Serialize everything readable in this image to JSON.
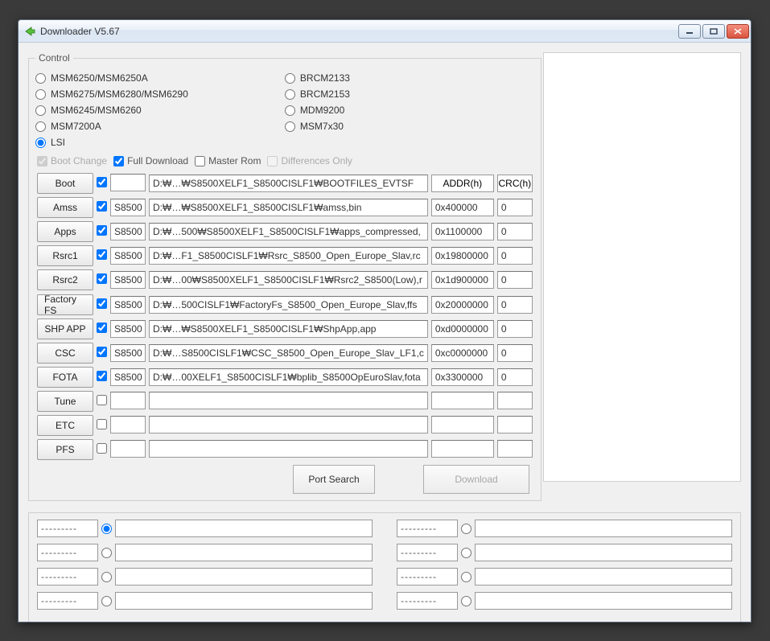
{
  "window": {
    "title": "Downloader V5.67"
  },
  "control": {
    "legend": "Control",
    "col1": [
      {
        "label": "MSM6250/MSM6250A",
        "selected": false
      },
      {
        "label": "MSM6275/MSM6280/MSM6290",
        "selected": false
      },
      {
        "label": "MSM6245/MSM6260",
        "selected": false
      },
      {
        "label": "MSM7200A",
        "selected": false
      },
      {
        "label": "LSI",
        "selected": true
      }
    ],
    "col2": [
      {
        "label": "BRCM2133",
        "selected": false
      },
      {
        "label": "BRCM2153",
        "selected": false
      },
      {
        "label": "MDM9200",
        "selected": false
      },
      {
        "label": "MSM7x30",
        "selected": false
      }
    ]
  },
  "options": {
    "boot_change": {
      "label": "Boot Change",
      "checked": true,
      "disabled": true
    },
    "full_download": {
      "label": "Full Download",
      "checked": true,
      "disabled": false
    },
    "master_rom": {
      "label": "Master Rom",
      "checked": false,
      "disabled": false
    },
    "differences_only": {
      "label": "Differences Only",
      "checked": false,
      "disabled": true
    }
  },
  "headers": {
    "addr": "ADDR(h)",
    "crc": "CRC(h)"
  },
  "rows": [
    {
      "btn": "Boot",
      "chk": true,
      "model": "",
      "path": "D:₩…₩S8500XELF1_S8500CISLF1₩BOOTFILES_EVTSF",
      "addr": "",
      "crc": ""
    },
    {
      "btn": "Amss",
      "chk": true,
      "model": "S8500",
      "path": "D:₩…₩S8500XELF1_S8500CISLF1₩amss,bin",
      "addr": "0x400000",
      "crc": "0"
    },
    {
      "btn": "Apps",
      "chk": true,
      "model": "S8500",
      "path": "D:₩…500₩S8500XELF1_S8500CISLF1₩apps_compressed,",
      "addr": "0x1100000",
      "crc": "0"
    },
    {
      "btn": "Rsrc1",
      "chk": true,
      "model": "S8500",
      "path": "D:₩…F1_S8500CISLF1₩Rsrc_S8500_Open_Europe_Slav,rc",
      "addr": "0x19800000",
      "crc": "0"
    },
    {
      "btn": "Rsrc2",
      "chk": true,
      "model": "S8500",
      "path": "D:₩…00₩S8500XELF1_S8500CISLF1₩Rsrc2_S8500(Low),r",
      "addr": "0x1d900000",
      "crc": "0"
    },
    {
      "btn": "Factory FS",
      "chk": true,
      "model": "S8500",
      "path": "D:₩…500CISLF1₩FactoryFs_S8500_Open_Europe_Slav,ffs",
      "addr": "0x20000000",
      "crc": "0"
    },
    {
      "btn": "SHP APP",
      "chk": true,
      "model": "S8500",
      "path": "D:₩…₩S8500XELF1_S8500CISLF1₩ShpApp,app",
      "addr": "0xd0000000",
      "crc": "0"
    },
    {
      "btn": "CSC",
      "chk": true,
      "model": "S8500",
      "path": "D:₩…S8500CISLF1₩CSC_S8500_Open_Europe_Slav_LF1,c",
      "addr": "0xc0000000",
      "crc": "0"
    },
    {
      "btn": "FOTA",
      "chk": true,
      "model": "S8500",
      "path": "D:₩…00XELF1_S8500CISLF1₩bplib_S8500OpEuroSlav,fota",
      "addr": "0x3300000",
      "crc": "0"
    },
    {
      "btn": "Tune",
      "chk": false,
      "model": "",
      "path": "",
      "addr": "",
      "crc": ""
    },
    {
      "btn": "ETC",
      "chk": false,
      "model": "",
      "path": "",
      "addr": "",
      "crc": ""
    },
    {
      "btn": "PFS",
      "chk": false,
      "model": "",
      "path": "",
      "addr": "",
      "crc": ""
    }
  ],
  "actions": {
    "port_search": "Port Search",
    "download": "Download"
  },
  "ports": {
    "placeholder": "---------",
    "selected_index": 0,
    "count": 8
  }
}
